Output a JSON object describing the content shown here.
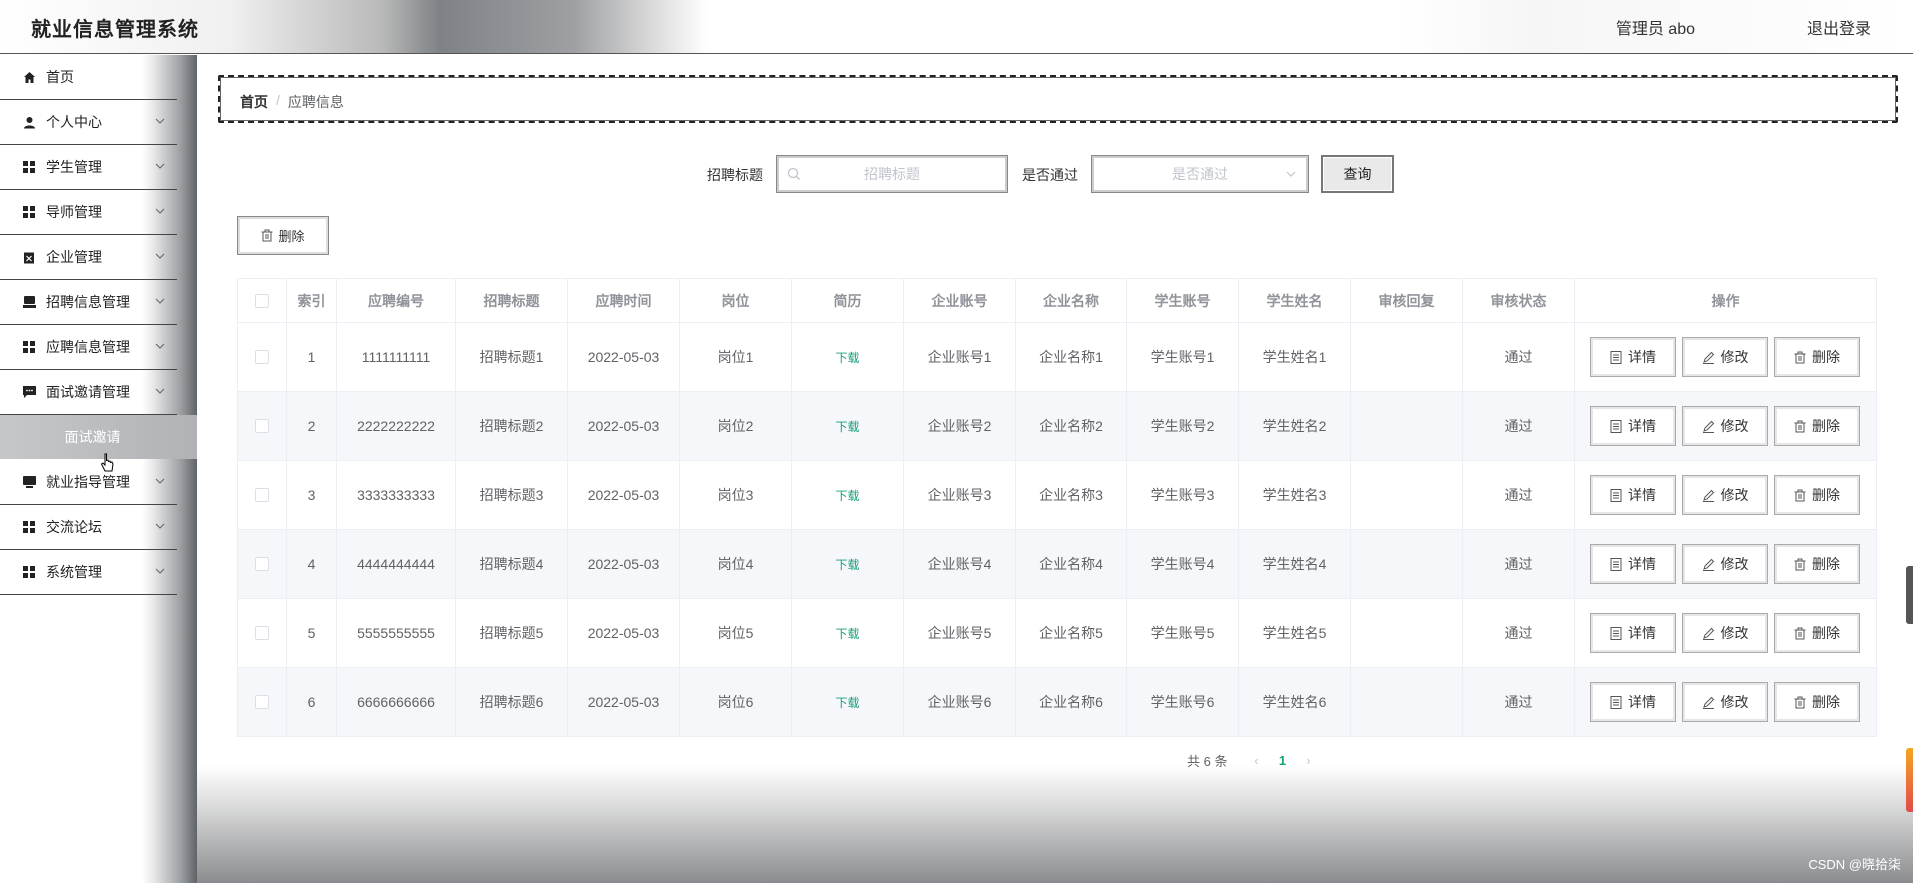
{
  "header": {
    "app_title": "就业信息管理系统",
    "user_info": "管理员 abo",
    "logout": "退出登录"
  },
  "sidebar": {
    "items": [
      {
        "label": "首页",
        "icon": "home-icon"
      },
      {
        "label": "个人中心",
        "icon": "user-icon"
      },
      {
        "label": "学生管理",
        "icon": "grid-icon"
      },
      {
        "label": "导师管理",
        "icon": "grid-icon"
      },
      {
        "label": "企业管理",
        "icon": "clipboard-icon"
      },
      {
        "label": "招聘信息管理",
        "icon": "printer-icon"
      },
      {
        "label": "应聘信息管理",
        "icon": "grid-icon"
      },
      {
        "label": "面试邀请管理",
        "icon": "chat-icon"
      },
      {
        "label": "就业指导管理",
        "icon": "monitor-icon"
      },
      {
        "label": "交流论坛",
        "icon": "grid-icon"
      },
      {
        "label": "系统管理",
        "icon": "grid-icon"
      }
    ],
    "active_submenu": "面试邀请"
  },
  "breadcrumb": {
    "home": "首页",
    "separator": "/",
    "current": "应聘信息"
  },
  "search": {
    "title_label": "招聘标题",
    "title_placeholder": "招聘标题",
    "passed_label": "是否通过",
    "passed_placeholder": "是否通过",
    "query_button": "查询"
  },
  "toolbar": {
    "delete_label": "删除"
  },
  "table": {
    "columns": [
      "",
      "索引",
      "应聘编号",
      "招聘标题",
      "应聘时间",
      "岗位",
      "简历",
      "企业账号",
      "企业名称",
      "学生账号",
      "学生姓名",
      "审核回复",
      "审核状态",
      "操作"
    ],
    "rows": [
      {
        "index": "1",
        "app_no": "1111111111",
        "title": "招聘标题1",
        "time": "2022-05-03",
        "post": "岗位1",
        "resume": "下载",
        "ent_account": "企业账号1",
        "ent_name": "企业名称1",
        "stu_account": "学生账号1",
        "stu_name": "学生姓名1",
        "reply": "",
        "status": "通过"
      },
      {
        "index": "2",
        "app_no": "2222222222",
        "title": "招聘标题2",
        "time": "2022-05-03",
        "post": "岗位2",
        "resume": "下载",
        "ent_account": "企业账号2",
        "ent_name": "企业名称2",
        "stu_account": "学生账号2",
        "stu_name": "学生姓名2",
        "reply": "",
        "status": "通过"
      },
      {
        "index": "3",
        "app_no": "3333333333",
        "title": "招聘标题3",
        "time": "2022-05-03",
        "post": "岗位3",
        "resume": "下载",
        "ent_account": "企业账号3",
        "ent_name": "企业名称3",
        "stu_account": "学生账号3",
        "stu_name": "学生姓名3",
        "reply": "",
        "status": "通过"
      },
      {
        "index": "4",
        "app_no": "4444444444",
        "title": "招聘标题4",
        "time": "2022-05-03",
        "post": "岗位4",
        "resume": "下载",
        "ent_account": "企业账号4",
        "ent_name": "企业名称4",
        "stu_account": "学生账号4",
        "stu_name": "学生姓名4",
        "reply": "",
        "status": "通过"
      },
      {
        "index": "5",
        "app_no": "5555555555",
        "title": "招聘标题5",
        "time": "2022-05-03",
        "post": "岗位5",
        "resume": "下载",
        "ent_account": "企业账号5",
        "ent_name": "企业名称5",
        "stu_account": "学生账号5",
        "stu_name": "学生姓名5",
        "reply": "",
        "status": "通过"
      },
      {
        "index": "6",
        "app_no": "6666666666",
        "title": "招聘标题6",
        "time": "2022-05-03",
        "post": "岗位6",
        "resume": "下载",
        "ent_account": "企业账号6",
        "ent_name": "企业名称6",
        "stu_account": "学生账号6",
        "stu_name": "学生姓名6",
        "reply": "",
        "status": "通过"
      }
    ],
    "actions": {
      "detail": "详情",
      "edit": "修改",
      "delete": "删除"
    }
  },
  "pagination": {
    "total": "共 6 条",
    "current_page": "1"
  },
  "watermark": "CSDN @晓拾柒"
}
